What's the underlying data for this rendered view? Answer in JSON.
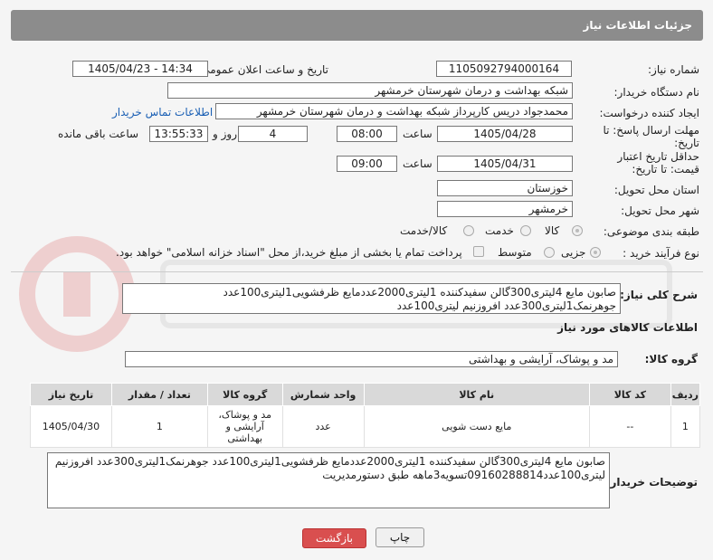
{
  "header": {
    "title": "جزئیات اطلاعات نیاز"
  },
  "fields": {
    "need_number_label": "شماره نیاز:",
    "need_number": "1105092794000164",
    "announce_label": "تاریخ و ساعت اعلان عمومی:",
    "announce_value": "1405/04/23 - 14:34",
    "buyer_org_label": "نام دستگاه خریدار:",
    "buyer_org": "شبکه بهداشت و درمان شهرستان خرمشهر",
    "requester_label": "ایجاد کننده درخواست:",
    "requester": "محمدجواد دریس کارپرداز شبکه بهداشت و درمان شهرستان خرمشهر",
    "buyer_contact_link": "اطلاعات تماس خریدار",
    "reply_deadline_label": "مهلت ارسال پاسخ: تا تاریخ:",
    "reply_date": "1405/04/28",
    "time_label": "ساعت",
    "reply_time": "08:00",
    "days_value": "4",
    "days_label": "روز و",
    "remaining_time": "13:55:33",
    "remaining_label": "ساعت باقی مانده",
    "price_validity_label": "حداقل تاریخ اعتبار قیمت: تا تاریخ:",
    "price_date": "1405/04/31",
    "price_time": "09:00",
    "province_label": "استان محل تحویل:",
    "province": "خوزستان",
    "city_label": "شهر محل تحویل:",
    "city": "خرمشهر",
    "category_label": "طبقه بندی موضوعی:",
    "category_options": [
      "کالا",
      "خدمت",
      "کالا/خدمت"
    ],
    "process_label": "نوع فرآیند خرید :",
    "process_options": [
      "جزیی",
      "متوسط"
    ],
    "payment_note": "پرداخت تمام یا بخشی از مبلغ خرید،از محل \"اسناد خزانه اسلامی\" خواهد بود.",
    "summary_label": "شرح کلی نیاز:",
    "summary": "صابون مایع 4لیتری300گالن سفیدکننده 1لیتری2000عددمایع ظرفشویی1لیتری100عدد جوهرنمک1لیتری300عدد افروزنیم لیتری100عدد",
    "items_heading": "اطلاعات کالاهای مورد نیاز",
    "goods_group_label": "گروه کالا:",
    "goods_group": "مد و پوشاک، آرایشی و بهداشتی",
    "buyer_notes_label": "توضیحات خریدار:",
    "buyer_notes": "صابون مایع 4لیتری300گالن سفیدکننده 1لیتری2000عددمایع ظرفشویی1لیتری100عدد جوهرنمک1لیتری300عدد افروزنیم لیتری100عدد09160288814تسویه3ماهه طبق دستورمدیریت"
  },
  "table": {
    "headers": [
      "ردیف",
      "کد کالا",
      "نام کالا",
      "واحد شمارش",
      "گروه کالا",
      "تعداد / مقدار",
      "تاریخ نیاز"
    ],
    "rows": [
      [
        "1",
        "--",
        "مایع دست شویی",
        "عدد",
        "مد و پوشاک، آرایشی و بهداشتی",
        "1",
        "1405/04/30"
      ]
    ]
  },
  "buttons": {
    "print": "چاپ",
    "back": "بازگشت"
  },
  "colors": {
    "header_bg": "#8c8c8c",
    "back_button": "#d94f4f",
    "link": "#1a5fb4"
  }
}
